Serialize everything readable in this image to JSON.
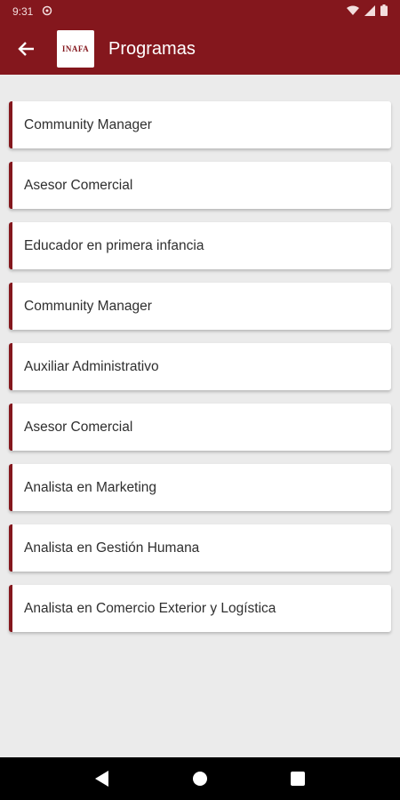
{
  "status_bar": {
    "time": "9:31"
  },
  "app_bar": {
    "title": "Programas",
    "logo_text": "INAFA"
  },
  "programs": [
    {
      "label": "Community Manager"
    },
    {
      "label": "Asesor Comercial"
    },
    {
      "label": "Educador en primera infancia"
    },
    {
      "label": "Community Manager"
    },
    {
      "label": "Auxiliar Administrativo"
    },
    {
      "label": "Asesor Comercial"
    },
    {
      "label": "Analista en Marketing"
    },
    {
      "label": "Analista en Gestión Humana"
    },
    {
      "label": "Analista en Comercio Exterior y Logística"
    }
  ],
  "colors": {
    "primary": "#84171d",
    "background": "#ebebeb",
    "card": "#ffffff"
  },
  "icons": [
    "back-arrow-icon",
    "wifi-icon",
    "signal-icon",
    "battery-icon",
    "nav-back-icon",
    "nav-home-icon",
    "nav-recents-icon"
  ]
}
